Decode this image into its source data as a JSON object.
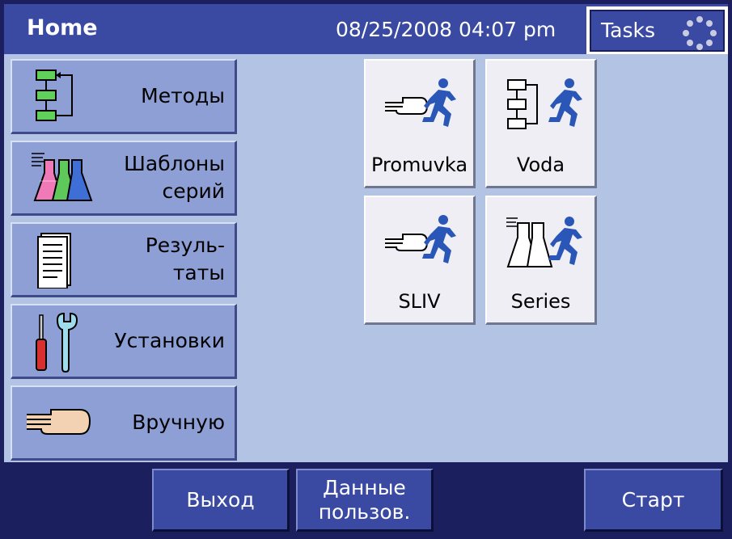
{
  "header": {
    "title": "Home",
    "datetime": "08/25/2008 04:07 pm",
    "tasks_label": "Tasks"
  },
  "sidebar": {
    "items": [
      {
        "line1": "Методы",
        "line2": "",
        "icon": "method-flowchart-icon"
      },
      {
        "line1": "Шаблоны",
        "line2": "серий",
        "icon": "flasks-icon"
      },
      {
        "line1": "Резуль-",
        "line2": "таты",
        "icon": "document-icon"
      },
      {
        "line1": "Установки",
        "line2": "",
        "icon": "tools-icon"
      },
      {
        "line1": "Вручную",
        "line2": "",
        "icon": "hand-icon"
      }
    ]
  },
  "tiles": [
    {
      "label": "Promuvka",
      "icon": "hand-runner-icon"
    },
    {
      "label": "Voda",
      "icon": "flowchart-runner-icon"
    },
    {
      "label": "SLIV",
      "icon": "hand-runner-icon"
    },
    {
      "label": "Series",
      "icon": "flask-runner-icon"
    }
  ],
  "footer": {
    "exit_label": "Выход",
    "user_line1": "Данные",
    "user_line2": "пользов.",
    "start_label": "Старт"
  },
  "colors": {
    "frame": "#1c1f5e",
    "header": "#3a4aa3",
    "panel": "#b3c3e4",
    "side_button": "#8e9fd6",
    "tile": "#eeeef4",
    "runner": "#2a56b8"
  }
}
